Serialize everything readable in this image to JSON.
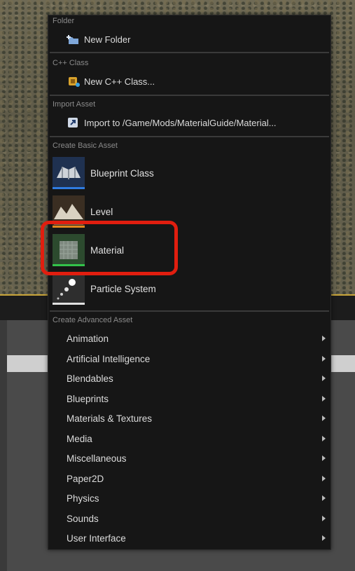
{
  "menu": {
    "folder": {
      "header": "Folder",
      "item": "New Folder"
    },
    "cpp": {
      "header": "C++ Class",
      "item": "New C++ Class..."
    },
    "import": {
      "header": "Import Asset",
      "item": "Import to /Game/Mods/MaterialGuide/Material..."
    },
    "basic": {
      "header": "Create Basic Asset",
      "items": [
        {
          "label": "Blueprint Class",
          "icon": "blueprint-icon",
          "bar_color": "#2f7be0"
        },
        {
          "label": "Level",
          "icon": "level-icon",
          "bar_color": "#e08a1e"
        },
        {
          "label": "Material",
          "icon": "material-icon",
          "bar_color": "#33c24a"
        },
        {
          "label": "Particle System",
          "icon": "particle-system-icon",
          "bar_color": "#e0e0e0"
        }
      ]
    },
    "advanced": {
      "header": "Create Advanced Asset",
      "items": [
        "Animation",
        "Artificial Intelligence",
        "Blendables",
        "Blueprints",
        "Materials & Textures",
        "Media",
        "Miscellaneous",
        "Paper2D",
        "Physics",
        "Sounds",
        "User Interface"
      ]
    }
  },
  "colors": {
    "highlight": "#e11e0f",
    "menu_bg": "#161616"
  }
}
